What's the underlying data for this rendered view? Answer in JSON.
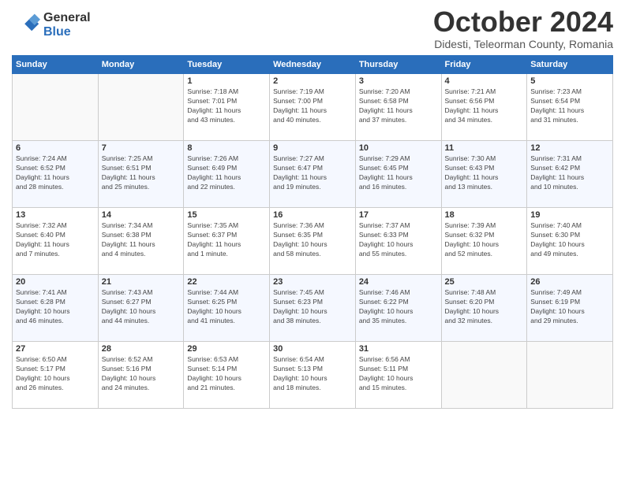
{
  "logo": {
    "general": "General",
    "blue": "Blue"
  },
  "title": "October 2024",
  "subtitle": "Didesti, Teleorman County, Romania",
  "headers": [
    "Sunday",
    "Monday",
    "Tuesday",
    "Wednesday",
    "Thursday",
    "Friday",
    "Saturday"
  ],
  "weeks": [
    [
      {
        "day": "",
        "info": ""
      },
      {
        "day": "",
        "info": ""
      },
      {
        "day": "1",
        "info": "Sunrise: 7:18 AM\nSunset: 7:01 PM\nDaylight: 11 hours\nand 43 minutes."
      },
      {
        "day": "2",
        "info": "Sunrise: 7:19 AM\nSunset: 7:00 PM\nDaylight: 11 hours\nand 40 minutes."
      },
      {
        "day": "3",
        "info": "Sunrise: 7:20 AM\nSunset: 6:58 PM\nDaylight: 11 hours\nand 37 minutes."
      },
      {
        "day": "4",
        "info": "Sunrise: 7:21 AM\nSunset: 6:56 PM\nDaylight: 11 hours\nand 34 minutes."
      },
      {
        "day": "5",
        "info": "Sunrise: 7:23 AM\nSunset: 6:54 PM\nDaylight: 11 hours\nand 31 minutes."
      }
    ],
    [
      {
        "day": "6",
        "info": "Sunrise: 7:24 AM\nSunset: 6:52 PM\nDaylight: 11 hours\nand 28 minutes."
      },
      {
        "day": "7",
        "info": "Sunrise: 7:25 AM\nSunset: 6:51 PM\nDaylight: 11 hours\nand 25 minutes."
      },
      {
        "day": "8",
        "info": "Sunrise: 7:26 AM\nSunset: 6:49 PM\nDaylight: 11 hours\nand 22 minutes."
      },
      {
        "day": "9",
        "info": "Sunrise: 7:27 AM\nSunset: 6:47 PM\nDaylight: 11 hours\nand 19 minutes."
      },
      {
        "day": "10",
        "info": "Sunrise: 7:29 AM\nSunset: 6:45 PM\nDaylight: 11 hours\nand 16 minutes."
      },
      {
        "day": "11",
        "info": "Sunrise: 7:30 AM\nSunset: 6:43 PM\nDaylight: 11 hours\nand 13 minutes."
      },
      {
        "day": "12",
        "info": "Sunrise: 7:31 AM\nSunset: 6:42 PM\nDaylight: 11 hours\nand 10 minutes."
      }
    ],
    [
      {
        "day": "13",
        "info": "Sunrise: 7:32 AM\nSunset: 6:40 PM\nDaylight: 11 hours\nand 7 minutes."
      },
      {
        "day": "14",
        "info": "Sunrise: 7:34 AM\nSunset: 6:38 PM\nDaylight: 11 hours\nand 4 minutes."
      },
      {
        "day": "15",
        "info": "Sunrise: 7:35 AM\nSunset: 6:37 PM\nDaylight: 11 hours\nand 1 minute."
      },
      {
        "day": "16",
        "info": "Sunrise: 7:36 AM\nSunset: 6:35 PM\nDaylight: 10 hours\nand 58 minutes."
      },
      {
        "day": "17",
        "info": "Sunrise: 7:37 AM\nSunset: 6:33 PM\nDaylight: 10 hours\nand 55 minutes."
      },
      {
        "day": "18",
        "info": "Sunrise: 7:39 AM\nSunset: 6:32 PM\nDaylight: 10 hours\nand 52 minutes."
      },
      {
        "day": "19",
        "info": "Sunrise: 7:40 AM\nSunset: 6:30 PM\nDaylight: 10 hours\nand 49 minutes."
      }
    ],
    [
      {
        "day": "20",
        "info": "Sunrise: 7:41 AM\nSunset: 6:28 PM\nDaylight: 10 hours\nand 46 minutes."
      },
      {
        "day": "21",
        "info": "Sunrise: 7:43 AM\nSunset: 6:27 PM\nDaylight: 10 hours\nand 44 minutes."
      },
      {
        "day": "22",
        "info": "Sunrise: 7:44 AM\nSunset: 6:25 PM\nDaylight: 10 hours\nand 41 minutes."
      },
      {
        "day": "23",
        "info": "Sunrise: 7:45 AM\nSunset: 6:23 PM\nDaylight: 10 hours\nand 38 minutes."
      },
      {
        "day": "24",
        "info": "Sunrise: 7:46 AM\nSunset: 6:22 PM\nDaylight: 10 hours\nand 35 minutes."
      },
      {
        "day": "25",
        "info": "Sunrise: 7:48 AM\nSunset: 6:20 PM\nDaylight: 10 hours\nand 32 minutes."
      },
      {
        "day": "26",
        "info": "Sunrise: 7:49 AM\nSunset: 6:19 PM\nDaylight: 10 hours\nand 29 minutes."
      }
    ],
    [
      {
        "day": "27",
        "info": "Sunrise: 6:50 AM\nSunset: 5:17 PM\nDaylight: 10 hours\nand 26 minutes."
      },
      {
        "day": "28",
        "info": "Sunrise: 6:52 AM\nSunset: 5:16 PM\nDaylight: 10 hours\nand 24 minutes."
      },
      {
        "day": "29",
        "info": "Sunrise: 6:53 AM\nSunset: 5:14 PM\nDaylight: 10 hours\nand 21 minutes."
      },
      {
        "day": "30",
        "info": "Sunrise: 6:54 AM\nSunset: 5:13 PM\nDaylight: 10 hours\nand 18 minutes."
      },
      {
        "day": "31",
        "info": "Sunrise: 6:56 AM\nSunset: 5:11 PM\nDaylight: 10 hours\nand 15 minutes."
      },
      {
        "day": "",
        "info": ""
      },
      {
        "day": "",
        "info": ""
      }
    ]
  ]
}
